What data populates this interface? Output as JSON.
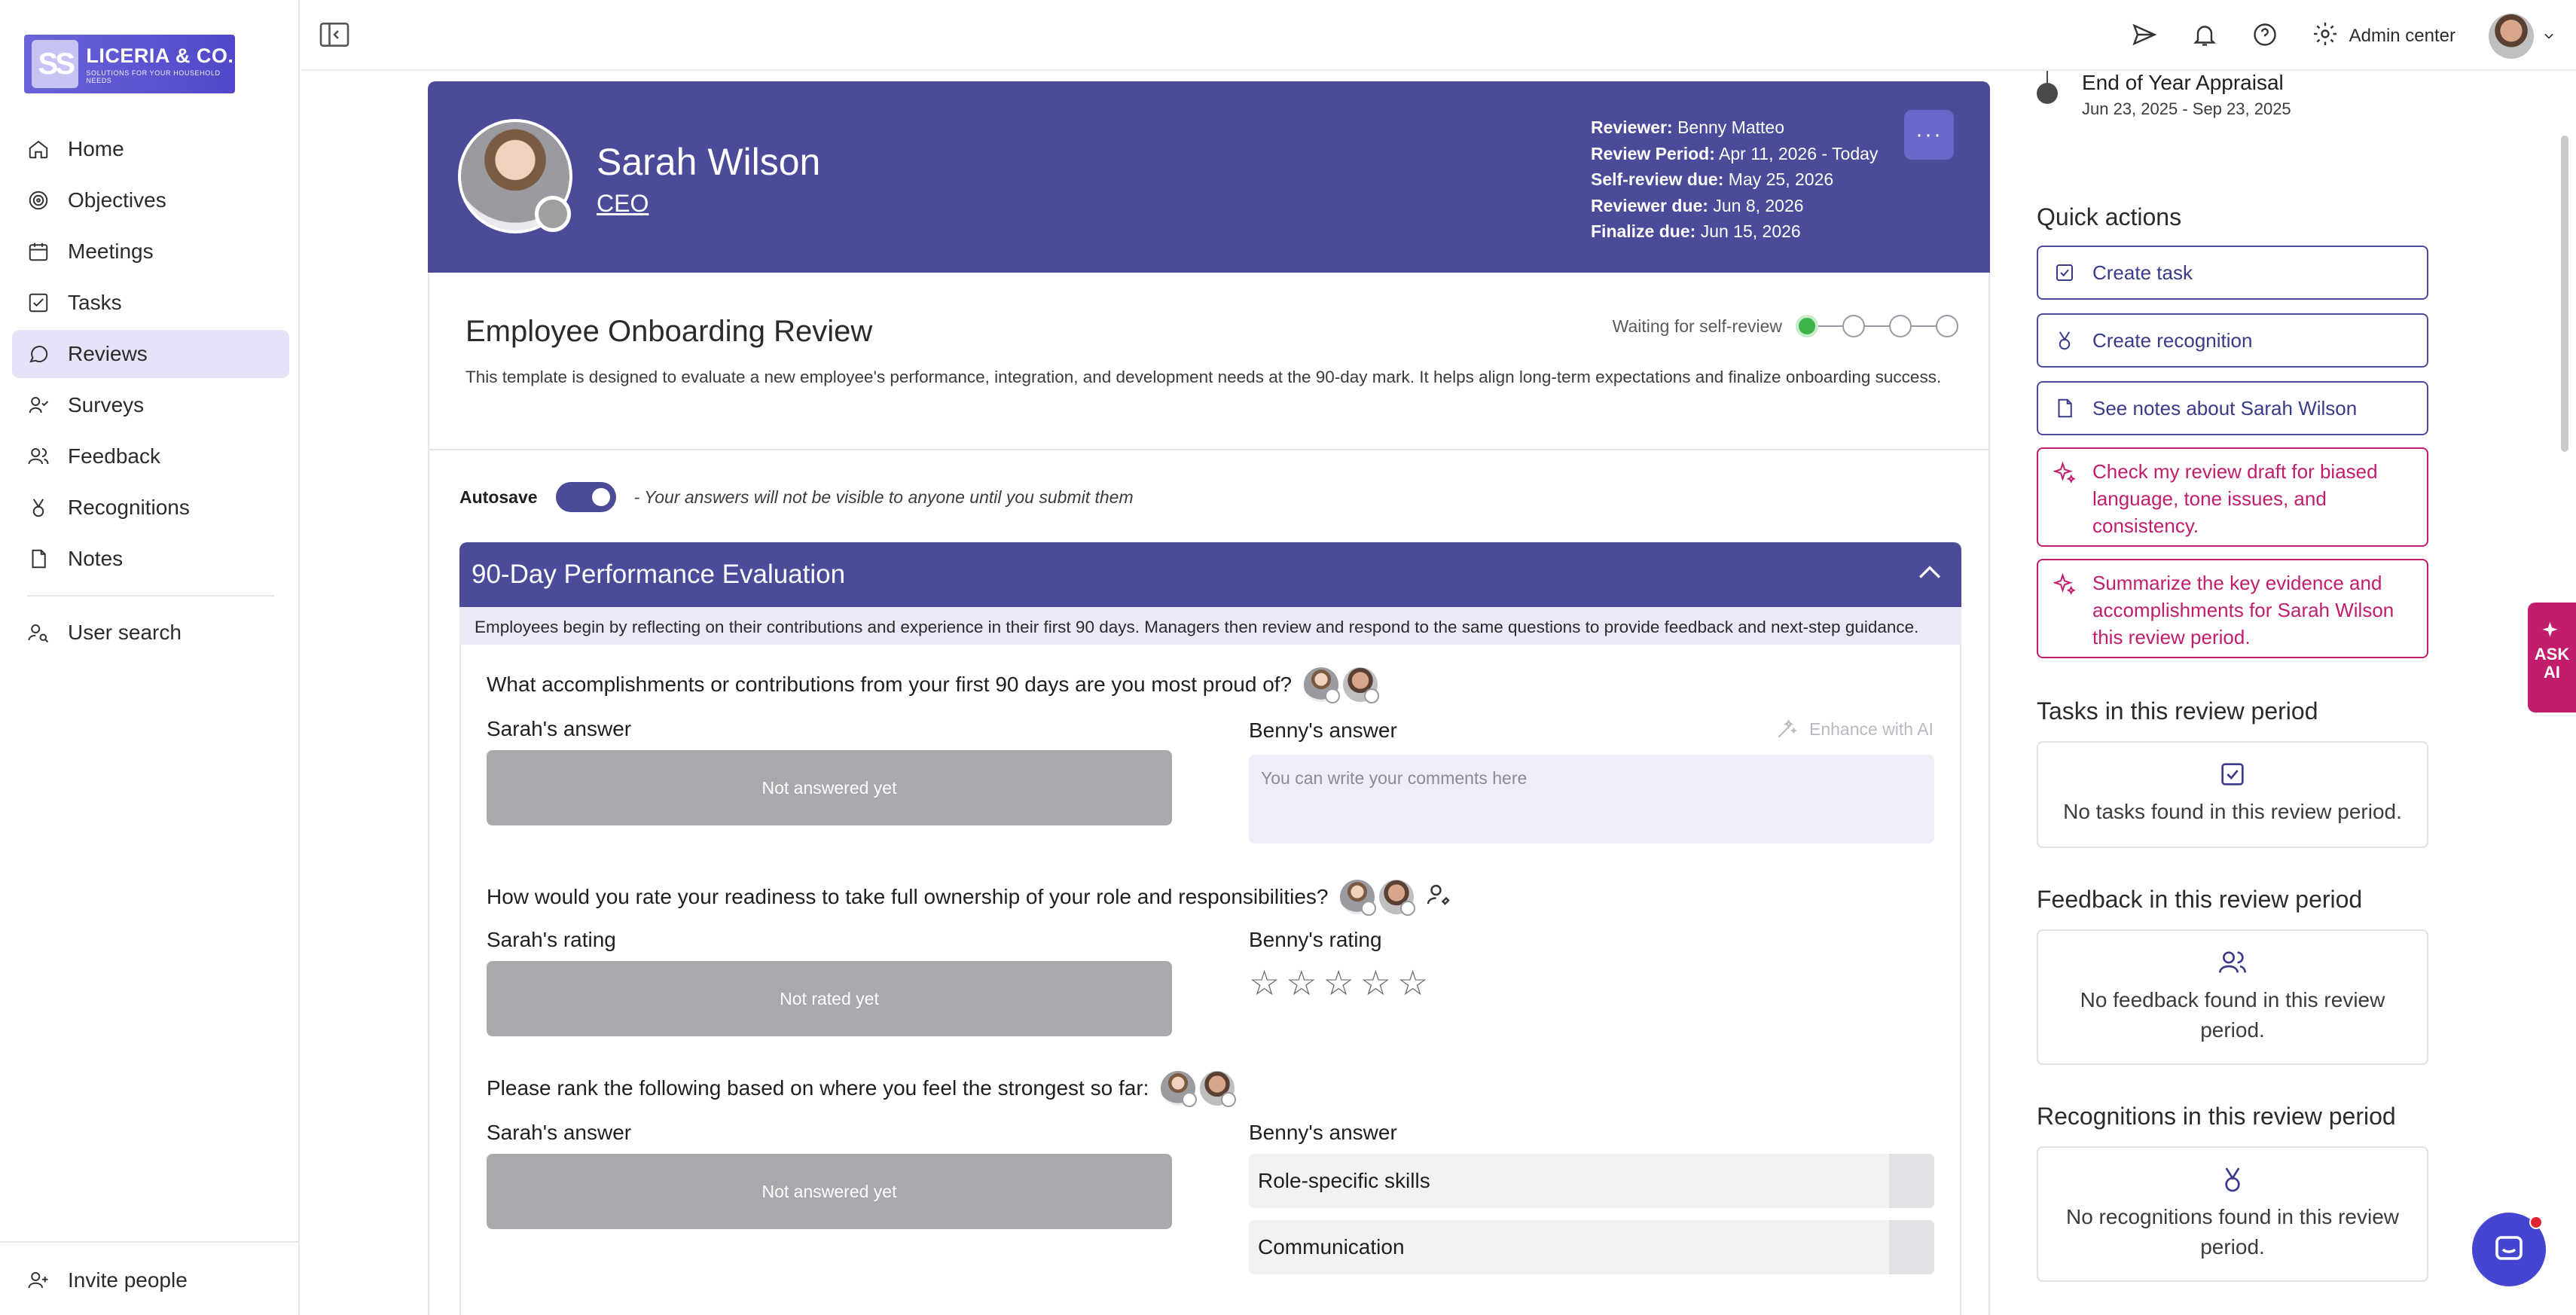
{
  "brand": {
    "mark": "SS",
    "name": "LICERIA & CO.",
    "tagline": "SOLUTIONS FOR YOUR HOUSEHOLD NEEDS"
  },
  "nav": {
    "items": [
      {
        "label": "Home",
        "icon": "home-icon"
      },
      {
        "label": "Objectives",
        "icon": "target-icon"
      },
      {
        "label": "Meetings",
        "icon": "calendar-icon"
      },
      {
        "label": "Tasks",
        "icon": "checkbox-icon"
      },
      {
        "label": "Reviews",
        "icon": "chat-bubble-icon",
        "active": true
      },
      {
        "label": "Surveys",
        "icon": "survey-icon"
      },
      {
        "label": "Feedback",
        "icon": "people-icon"
      },
      {
        "label": "Recognitions",
        "icon": "medal-icon"
      },
      {
        "label": "Notes",
        "icon": "note-icon"
      }
    ],
    "user_search": "User search",
    "invite": "Invite people"
  },
  "topbar": {
    "admin_center": "Admin center"
  },
  "employee": {
    "name": "Sarah Wilson",
    "role": "CEO",
    "meta": [
      {
        "label": "Reviewer:",
        "value": "Benny Matteo"
      },
      {
        "label": "Review Period:",
        "value": "Apr 11, 2026 - Today"
      },
      {
        "label": "Self-review due:",
        "value": "May 25, 2026"
      },
      {
        "label": "Reviewer due:",
        "value": "Jun 8, 2026"
      },
      {
        "label": "Finalize due:",
        "value": "Jun 15, 2026"
      }
    ],
    "more": "···"
  },
  "review": {
    "title": "Employee Onboarding Review",
    "description": "This template is designed to evaluate a new employee's performance, integration, and development needs at the 90-day mark. It helps align long-term expectations and finalize onboarding success.",
    "status": "Waiting for self-review",
    "steps_total": 4,
    "steps_done": 1
  },
  "autosave": {
    "label": "Autosave",
    "enabled": true,
    "note": "- Your answers will not be visible to anyone until you submit them"
  },
  "section": {
    "title": "90-Day Performance Evaluation",
    "description": "Employees begin by reflecting on their contributions and experience in their first 90 days. Managers then review and respond to the same questions to provide feedback and next-step guidance.",
    "questions": [
      {
        "text": "What accomplishments or contributions from your first 90 days are you most proud of?",
        "self_label": "Sarah's answer",
        "self_value": "Not answered yet",
        "reviewer_label": "Benny's answer",
        "placeholder": "You can write your comments here",
        "enhance": "Enhance with AI"
      },
      {
        "text": "How would you rate your readiness to take full ownership of your role and responsibilities?",
        "self_label": "Sarah's rating",
        "self_value": "Not rated yet",
        "reviewer_label": "Benny's rating",
        "stars_max": 5,
        "stars_value": 0
      },
      {
        "text": "Please rank the following based on where you feel the strongest so far:",
        "self_label": "Sarah's answer",
        "self_value": "Not answered yet",
        "reviewer_label": "Benny's answer",
        "rank_items": [
          "Role-specific skills",
          "Communication"
        ]
      }
    ]
  },
  "rail": {
    "timeline": {
      "title": "End of Year Appraisal",
      "dates": "Jun 23, 2025 - Sep 23, 2025"
    },
    "quick_actions_title": "Quick actions",
    "quick_actions": [
      "Create task",
      "Create recognition",
      "See notes about Sarah Wilson",
      "Check my review draft for biased language, tone issues, and consistency.",
      "Summarize the key evidence and accomplishments for Sarah Wilson this review period."
    ],
    "tasks_title": "Tasks in this review period",
    "tasks_empty": "No tasks found in this review period.",
    "feedback_title": "Feedback in this review period",
    "feedback_empty": "No feedback found in this review period.",
    "recognitions_title": "Recognitions in this review period",
    "recognitions_empty": "No recognitions found in this review period."
  },
  "ask_ai": {
    "line1": "ASK",
    "line2": "AI"
  },
  "colors": {
    "primary": "#4b4b9a",
    "accent_ai": "#c21d6a",
    "success": "#3bb54a"
  }
}
